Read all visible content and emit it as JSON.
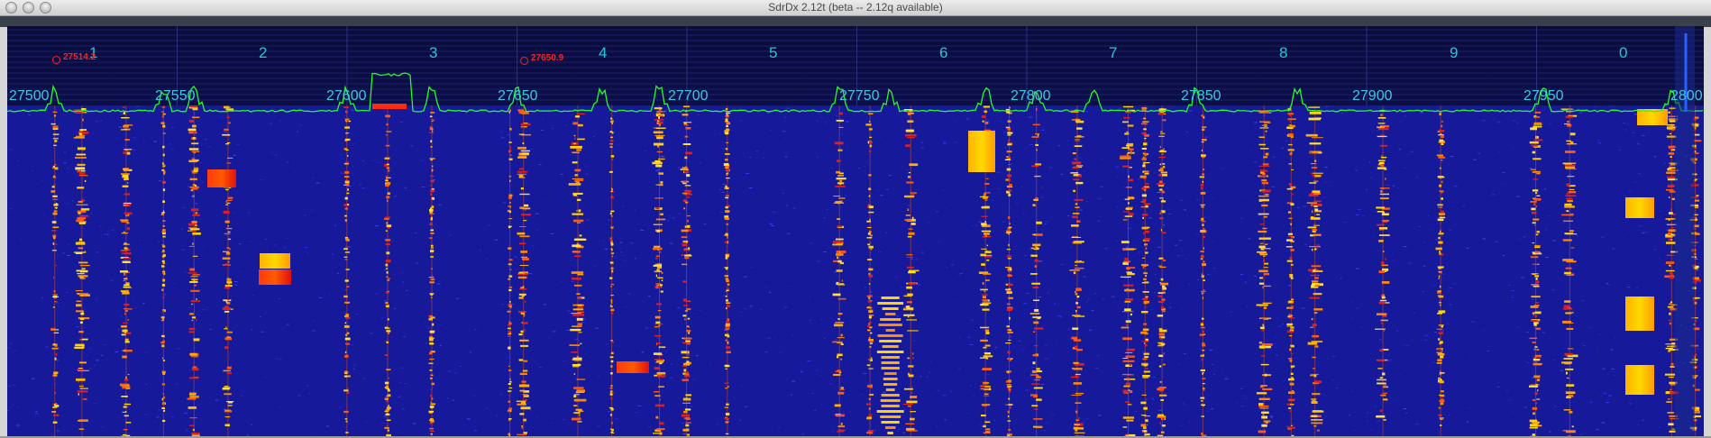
{
  "window": {
    "title": "SdrDx 2.12t (beta -- 2.12q available)"
  },
  "colors": {
    "background": "#0a0c45",
    "spectrum_line": "#22ff22",
    "channel_label": "#22c8d8",
    "freq_label": "#3ec8e0",
    "marker": "#ff2020"
  },
  "channels": [
    "1",
    "2",
    "3",
    "4",
    "5",
    "6",
    "7",
    "8",
    "9",
    "0"
  ],
  "freq_labels": [
    "27500",
    "27550",
    "27600",
    "27650",
    "27700",
    "27750",
    "27800",
    "27850",
    "27900",
    "27950",
    "2800"
  ],
  "markers": [
    {
      "label": "27514.2"
    },
    {
      "label": "27650.9"
    }
  ],
  "chart_data": {
    "type": "waterfall",
    "x_unit": "kHz",
    "xlim": [
      27500,
      28000
    ],
    "signals_khz": [
      27514,
      27522,
      27535,
      27546,
      27555,
      27565,
      27600,
      27612,
      27625,
      27648,
      27652,
      27668,
      27678,
      27692,
      27700,
      27712,
      27745,
      27754,
      27766,
      27788,
      27795,
      27803,
      27815,
      27830,
      27835,
      27840,
      27852,
      27870,
      27878,
      27885,
      27905,
      27922,
      27950,
      27960,
      27990,
      27997
    ],
    "spectrum_peaks_khz": [
      27514,
      27546,
      27555,
      27600,
      27610,
      27625,
      27650,
      27675,
      27692,
      27745,
      27760,
      27788,
      27803,
      27820,
      27850,
      27880,
      27952,
      27990
    ]
  }
}
